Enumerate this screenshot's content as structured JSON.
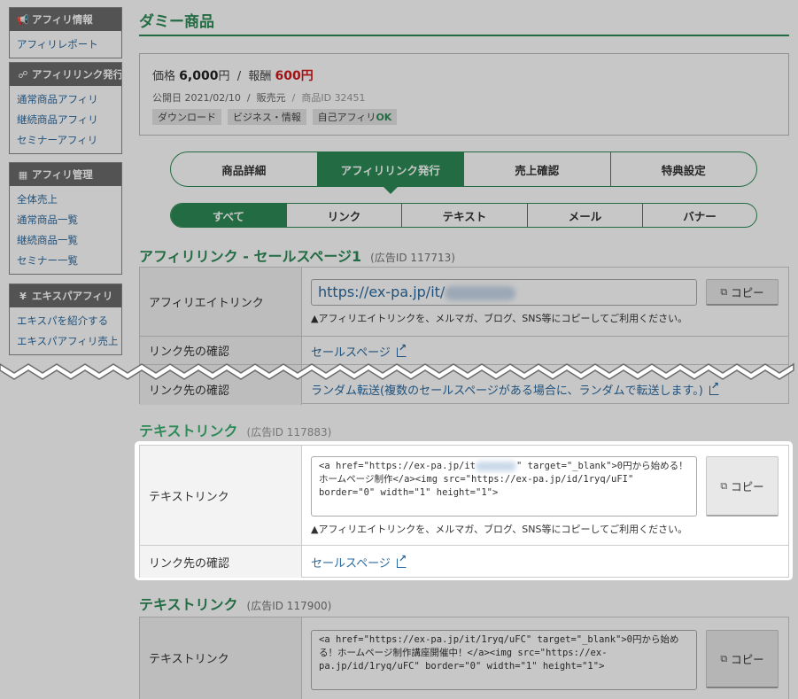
{
  "sidebar": [
    {
      "title": "アフィリ情報",
      "icon": "megaphone-icon",
      "links": [
        "アフィリレポート"
      ]
    },
    {
      "title": "アフィリリンク発行",
      "icon": "link-icon",
      "links": [
        "通常商品アフィリ",
        "継続商品アフィリ",
        "セミナーアフィリ"
      ]
    },
    {
      "title": "アフィリ管理",
      "icon": "document-icon",
      "links": [
        "全体売上",
        "通常商品一覧",
        "継続商品一覧",
        "セミナー一覧"
      ]
    },
    {
      "title": "エキスパアフィリ",
      "icon": "yen-icon",
      "links": [
        "エキスパを紹介する",
        "エキスパアフィリ売上"
      ]
    }
  ],
  "page": {
    "title": "ダミー商品"
  },
  "product": {
    "price_label": "価格",
    "price": "6,000",
    "yen": "円",
    "sep": "/",
    "reward_label": "報酬",
    "reward": "600",
    "date_label": "公開日",
    "date": "2021/02/10",
    "seller_label": "販売元",
    "id_label": "商品ID",
    "id": "32451",
    "tags": [
      "ダウンロード",
      "ビジネス・情報",
      "自己アフィリ"
    ],
    "ok": "OK"
  },
  "tabs": [
    "商品詳細",
    "アフィリリンク発行",
    "売上確認",
    "特典設定"
  ],
  "subtabs": [
    "すべて",
    "リンク",
    "テキスト",
    "メール",
    "バナー"
  ],
  "section1": {
    "title": "アフィリリンク - セールスページ1",
    "ad": "(広告ID 117713)",
    "row1_label": "アフィリエイトリンク",
    "url": "https://ex-pa.jp/it/",
    "copy": "コピー",
    "note": "▲アフィリエイトリンクを、メルマガ、ブログ、SNS等にコピーしてご利用ください。",
    "row2_label": "リンク先の確認",
    "row2_link": "セールスページ",
    "row3_label": "リンク先の確認",
    "row3_link": "ランダム転送(複数のセールスページがある場合に、ランダムで転送します。)"
  },
  "section2": {
    "title": "テキストリンク",
    "ad": "(広告ID 117883)",
    "row1_label": "テキストリンク",
    "code_a": "<a href=\"https://ex-pa.jp/it",
    "code_b": "\" target=\"_blank\">0円から始める！ホームページ制作</a><img src=\"https://ex-pa.jp/id/1ryq/uFI\" border=\"0\" width=\"1\" height=\"1\">",
    "copy": "コピー",
    "note": "▲アフィリエイトリンクを、メルマガ、ブログ、SNS等にコピーしてご利用ください。",
    "row2_label": "リンク先の確認",
    "row2_link": "セールスページ"
  },
  "section3": {
    "title": "テキストリンク",
    "ad": "(広告ID 117900)",
    "row1_label": "テキストリンク",
    "code": "<a href=\"https://ex-pa.jp/it/1ryq/uFC\" target=\"_blank\">0円から始める！ホームページ制作講座開催中！</a><img src=\"https://ex-pa.jp/id/1ryq/uFC\" border=\"0\" width=\"1\" height=\"1\">",
    "copy": "コピー"
  },
  "colors": {
    "accent": "#2e8b57",
    "link": "#2a6aa0",
    "reward": "#d0191b"
  }
}
